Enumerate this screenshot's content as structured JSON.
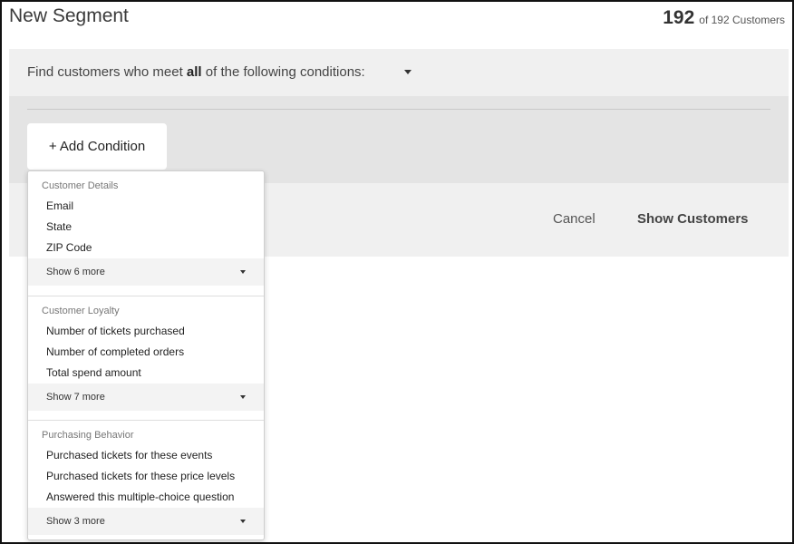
{
  "header": {
    "title": "New Segment",
    "count": "192",
    "count_suffix": "of 192 Customers"
  },
  "conditions": {
    "prefix": "Find customers who meet",
    "mode": "all",
    "suffix": "of the following conditions:"
  },
  "builder": {
    "add_condition_label": "+ Add Condition"
  },
  "footer": {
    "cancel_label": "Cancel",
    "show_label": "Show Customers"
  },
  "dropdown": {
    "groups": [
      {
        "header": "Customer Details",
        "items": [
          "Email",
          "State",
          "ZIP Code"
        ],
        "show_more": "Show 6 more"
      },
      {
        "header": "Customer Loyalty",
        "items": [
          "Number of tickets purchased",
          "Number of completed orders",
          "Total spend amount"
        ],
        "show_more": "Show 7 more"
      },
      {
        "header": "Purchasing Behavior",
        "items": [
          "Purchased tickets for these events",
          "Purchased tickets for these price levels",
          "Answered this multiple-choice question"
        ],
        "show_more": "Show 3 more"
      }
    ]
  },
  "icons": {
    "conditions_mode": "chevron-down-icon",
    "show_more": "chevron-down-icon"
  },
  "colors": {
    "panel_bg": "#f0f0f0",
    "builder_bg": "#e4e4e4",
    "text": "#333333"
  }
}
